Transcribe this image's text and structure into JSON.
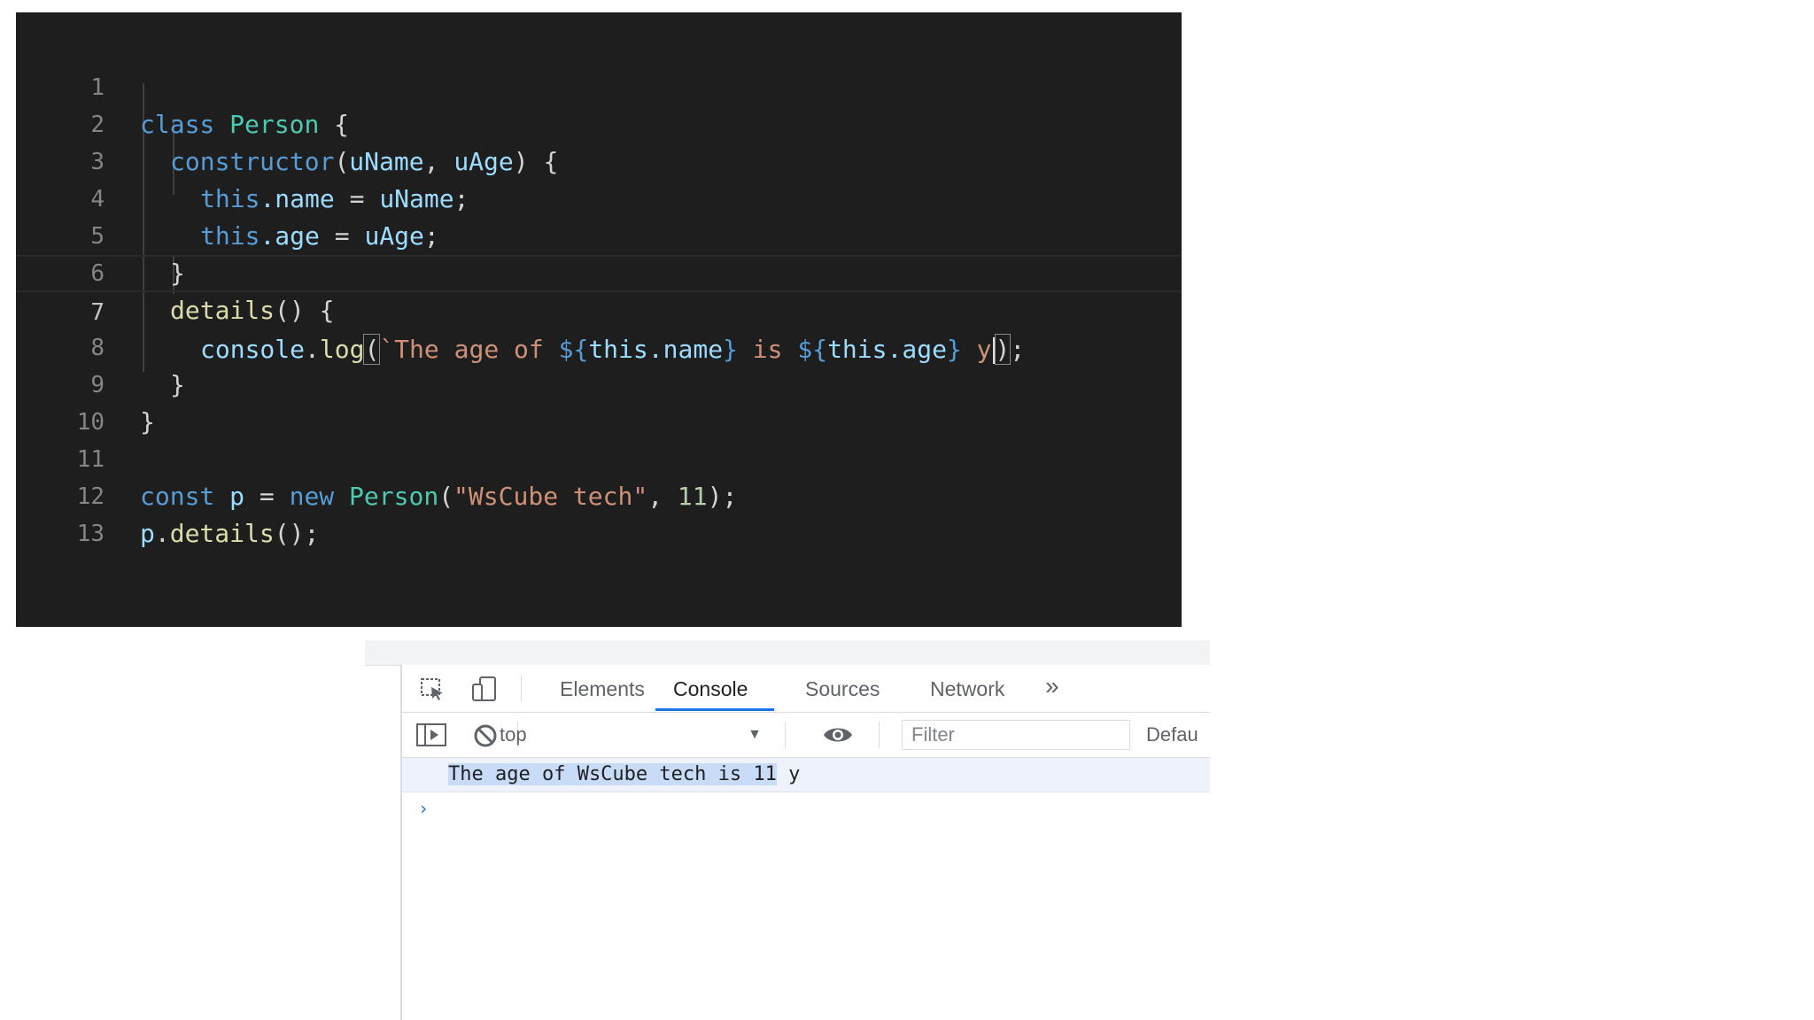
{
  "editor": {
    "lines": [
      {
        "num": "1"
      },
      {
        "num": "2"
      },
      {
        "num": "3"
      },
      {
        "num": "4"
      },
      {
        "num": "5"
      },
      {
        "num": "6"
      },
      {
        "num": "7"
      },
      {
        "num": "8"
      },
      {
        "num": "9"
      },
      {
        "num": "10"
      },
      {
        "num": "11"
      },
      {
        "num": "12"
      },
      {
        "num": "13"
      }
    ],
    "tokens": {
      "l1_class": "class",
      "l1_name": "Person",
      "l1_brace": " {",
      "l2_ctor": "constructor",
      "l2_open": "(",
      "l2_p1": "uName",
      "l2_comma": ", ",
      "l2_p2": "uAge",
      "l2_close": ") {",
      "l3_this": "this",
      "l3_prop": ".name",
      "l3_eq": " = ",
      "l3_val": "uName",
      "l3_semi": ";",
      "l4_this": "this",
      "l4_prop": ".age",
      "l4_eq": " = ",
      "l4_val": "uAge",
      "l4_semi": ";",
      "l5": "}",
      "l6_fn": "details",
      "l6_rest": "() {",
      "l7_console": "console",
      "l7_dot": ".",
      "l7_log": "log",
      "l7_open": "(",
      "l7_tick": "`",
      "l7_s1": "The age of ",
      "l7_t1o": "${",
      "l7_t1": "this.name",
      "l7_t1c": "}",
      "l7_s2": " is ",
      "l7_t2o": "${",
      "l7_t2": "this.age",
      "l7_t2c": "}",
      "l7_s3": " y",
      "l7_close": ")",
      "l7_semi": ";",
      "l8": "}",
      "l9": "}",
      "l11_const": "const",
      "l11_var": " p",
      "l11_eq": " = ",
      "l11_new": "new",
      "l11_cls": " Person",
      "l11_open": "(",
      "l11_str": "\"WsCube tech\"",
      "l11_comma": ", ",
      "l11_num": "11",
      "l11_close": ");",
      "l12_var": "p",
      "l12_dot": ".",
      "l12_fn": "details",
      "l12_rest": "();"
    }
  },
  "devtools": {
    "tabs": [
      {
        "label": "Elements"
      },
      {
        "label": "Console"
      },
      {
        "label": "Sources"
      },
      {
        "label": "Network"
      }
    ],
    "more_tabs": "»",
    "context": "top",
    "filter_placeholder": "Filter",
    "levels_label": "Defau",
    "console_output": {
      "selected": "The age of WsCube tech is 11",
      "rest": " y"
    },
    "prompt": "›"
  }
}
